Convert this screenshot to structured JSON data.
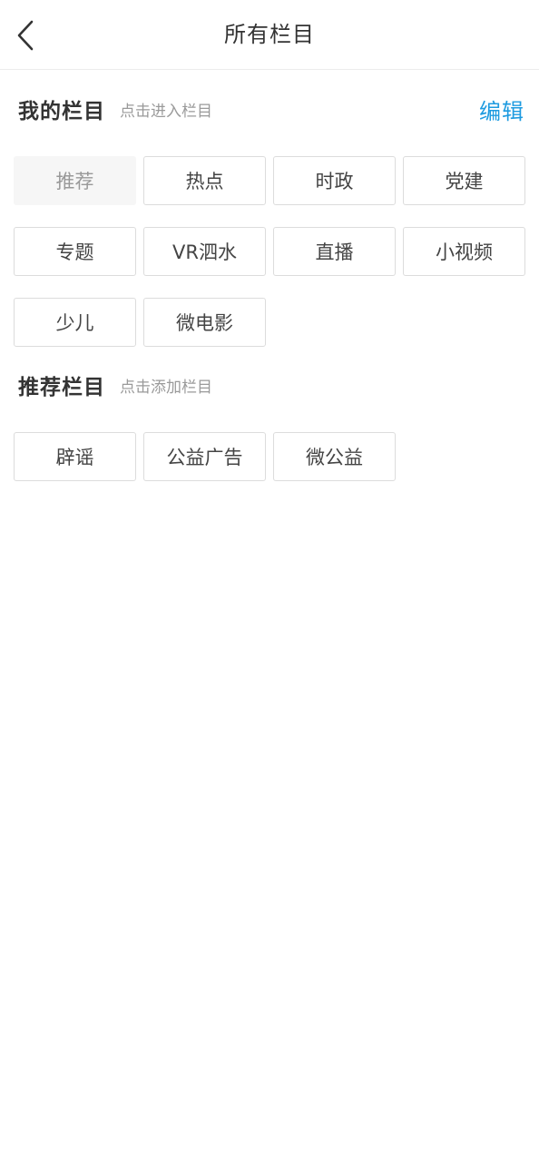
{
  "header": {
    "title": "所有栏目"
  },
  "my_section": {
    "title": "我的栏目",
    "hint": "点击进入栏目",
    "edit_label": "编辑",
    "items": [
      {
        "label": "推荐"
      },
      {
        "label": "热点"
      },
      {
        "label": "时政"
      },
      {
        "label": "党建"
      },
      {
        "label": "专题"
      },
      {
        "label": "VR泗水"
      },
      {
        "label": "直播"
      },
      {
        "label": "小视频"
      },
      {
        "label": "少儿"
      },
      {
        "label": "微电影"
      }
    ]
  },
  "recommended_section": {
    "title": "推荐栏目",
    "hint": "点击添加栏目",
    "items": [
      {
        "label": "辟谣"
      },
      {
        "label": "公益广告"
      },
      {
        "label": "微公益"
      }
    ]
  },
  "colors": {
    "accent": "#1e9be0",
    "chip_border": "#dcdcdc",
    "fixed_chip_bg": "#f6f6f6"
  }
}
